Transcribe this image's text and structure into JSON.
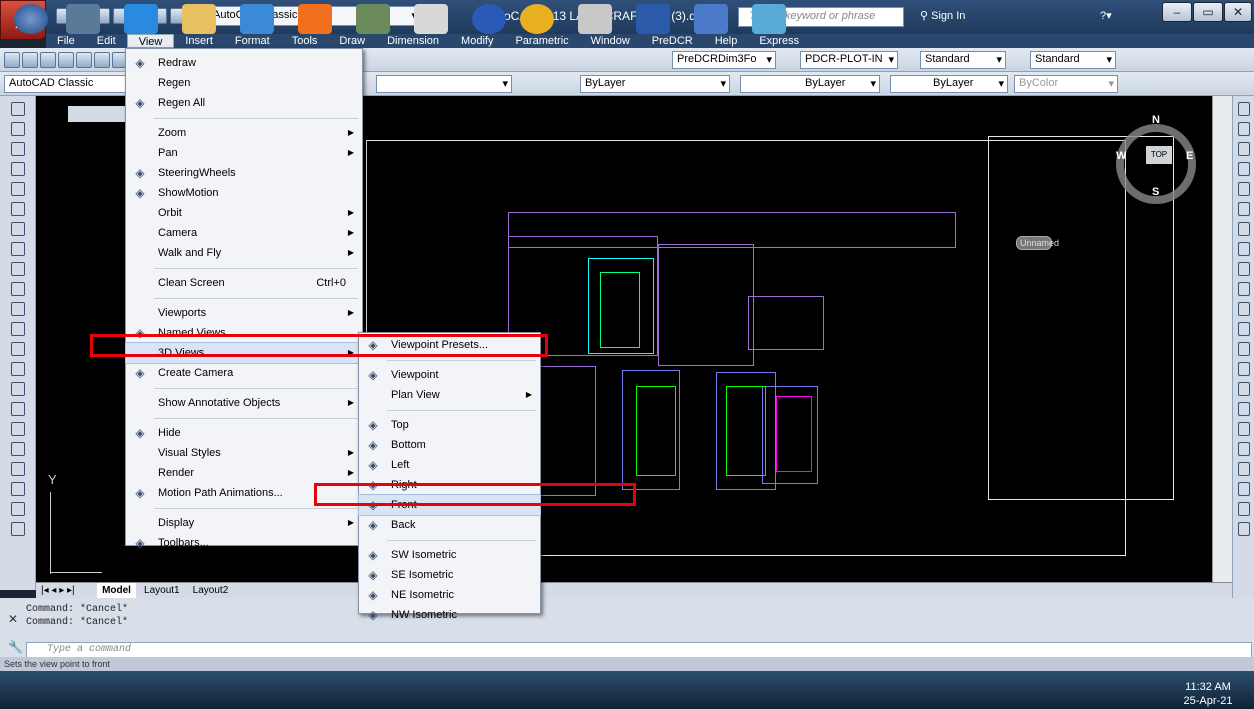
{
  "title_bar": {
    "workspace": "AutoCAD Classic",
    "app_title": "AutoCAD 2013   LAND CRAFT 105 (3).dwg",
    "search_placeholder": "Type a keyword or phrase",
    "signin": "Sign In"
  },
  "menubar": [
    "File",
    "Edit",
    "View",
    "Insert",
    "Format",
    "Tools",
    "Draw",
    "Dimension",
    "Modify",
    "Parametric",
    "Window",
    "PreDCR",
    "Help",
    "Express"
  ],
  "toolbar1": {
    "dimstyle": "PreDCRDim3Fo",
    "plotstyle": "PDCR-PLOT-IN",
    "textstyle": "Standard",
    "tablestyle": "Standard"
  },
  "toolbar2": {
    "workspace": "AutoCAD Classic",
    "color": "ByLayer",
    "linetype": "ByLayer",
    "lineweight": "ByLayer",
    "plot_color": "ByColor"
  },
  "view_menu": [
    {
      "label": "Redraw",
      "icon": "pencil-icon"
    },
    {
      "label": "Regen"
    },
    {
      "label": "Regen All",
      "icon": "regen-all-icon"
    },
    {
      "sep": true
    },
    {
      "label": "Zoom",
      "sub": true
    },
    {
      "label": "Pan",
      "sub": true
    },
    {
      "label": "SteeringWheels",
      "icon": "steering-wheel-icon"
    },
    {
      "label": "ShowMotion",
      "icon": "showmotion-icon"
    },
    {
      "label": "Orbit",
      "sub": true
    },
    {
      "label": "Camera",
      "sub": true
    },
    {
      "label": "Walk and Fly",
      "sub": true
    },
    {
      "sep": true
    },
    {
      "label": "Clean Screen",
      "shortcut": "Ctrl+0"
    },
    {
      "sep": true
    },
    {
      "label": "Viewports",
      "sub": true
    },
    {
      "label": "Named Views...",
      "icon": "named-views-icon"
    },
    {
      "label": "3D Views",
      "sub": true,
      "hl": true
    },
    {
      "label": "Create Camera",
      "icon": "camera-icon"
    },
    {
      "sep": true
    },
    {
      "label": "Show Annotative Objects",
      "sub": true
    },
    {
      "sep": true
    },
    {
      "label": "Hide",
      "icon": "hide-icon"
    },
    {
      "label": "Visual Styles",
      "sub": true
    },
    {
      "label": "Render",
      "sub": true
    },
    {
      "label": "Motion Path Animations...",
      "icon": "motion-path-icon"
    },
    {
      "sep": true
    },
    {
      "label": "Display",
      "sub": true
    },
    {
      "label": "Toolbars...",
      "icon": "toolbars-icon"
    }
  ],
  "sub_menu": [
    {
      "label": "Viewpoint Presets...",
      "icon": "viewpoint-presets-icon"
    },
    {
      "sep": true
    },
    {
      "label": "Viewpoint",
      "icon": "viewpoint-icon"
    },
    {
      "label": "Plan View",
      "sub": true
    },
    {
      "sep": true
    },
    {
      "label": "Top",
      "icon": "top-view-icon"
    },
    {
      "label": "Bottom",
      "icon": "bottom-view-icon"
    },
    {
      "label": "Left",
      "icon": "left-view-icon"
    },
    {
      "label": "Right",
      "icon": "right-view-icon"
    },
    {
      "label": "Front",
      "icon": "front-view-icon",
      "hl": true
    },
    {
      "label": "Back",
      "icon": "back-view-icon"
    },
    {
      "sep": true
    },
    {
      "label": "SW Isometric",
      "icon": "sw-isometric-icon"
    },
    {
      "label": "SE Isometric",
      "icon": "se-isometric-icon"
    },
    {
      "label": "NE Isometric",
      "icon": "ne-isometric-icon"
    },
    {
      "label": "NW Isometric",
      "icon": "nw-isometric-icon"
    }
  ],
  "viewcube": {
    "north": "N",
    "south": "S",
    "west": "W",
    "east": "E",
    "face": "TOP",
    "ucs": "Unnamed"
  },
  "tabs": [
    "Model",
    "Layout1",
    "Layout2"
  ],
  "ucs_label": "Y",
  "command_history": [
    "Command: *Cancel*",
    "Command: *Cancel*"
  ],
  "command_placeholder": "Type a command",
  "status_text": "Sets the view point to front",
  "clock": {
    "time": "11:32 AM",
    "date": "25-Apr-21"
  }
}
